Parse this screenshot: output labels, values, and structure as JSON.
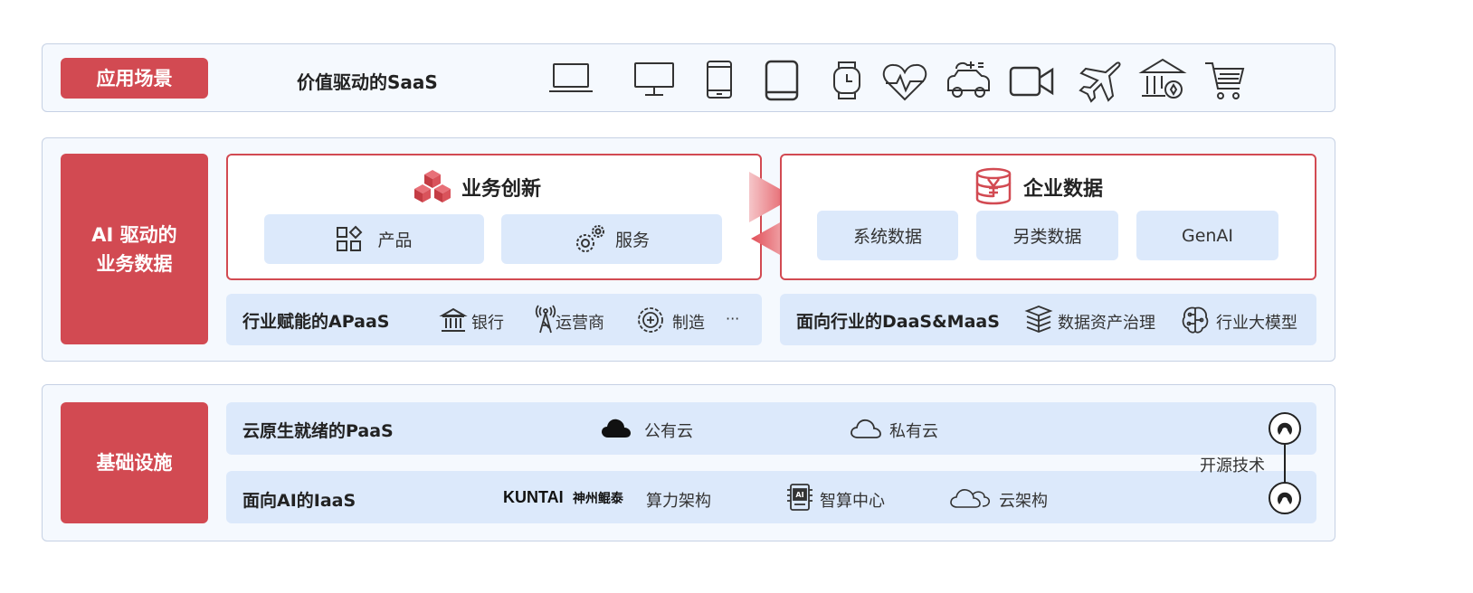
{
  "scenario": {
    "label": "应用场景",
    "title": "价值驱动的SaaS",
    "icons": [
      "laptop-icon",
      "monitor-icon",
      "phone-icon",
      "tablet-icon",
      "watch-icon",
      "health-heart-icon",
      "car-icon",
      "video-camera-icon",
      "airplane-icon",
      "bank-icon",
      "shopping-cart-icon"
    ]
  },
  "ai": {
    "label_line1": "AI 驱动的",
    "label_line2": "业务数据",
    "innovation": {
      "title": "业务创新",
      "items": [
        "产品",
        "服务"
      ]
    },
    "enterprise": {
      "title": "企业数据",
      "items": [
        "系统数据",
        "另类数据",
        "GenAI"
      ]
    },
    "apaas": {
      "title": "行业赋能的APaaS",
      "items": [
        "银行",
        "运营商",
        "制造"
      ],
      "more": "···"
    },
    "daas": {
      "title": "面向行业的DaaS&MaaS",
      "items": [
        "数据资产治理",
        "行业大模型"
      ]
    }
  },
  "infra": {
    "label": "基础设施",
    "paas": {
      "title": "云原生就绪的PaaS",
      "items": [
        "公有云",
        "私有云"
      ]
    },
    "iaas": {
      "title": "面向AI的IaaS",
      "brand": "KUNTAI",
      "brand_cn": "神州鲲泰",
      "items": [
        "算力架构",
        "智算中心",
        "云架构"
      ]
    },
    "open_source": "开源技术"
  },
  "colors": {
    "accent_red": "#d24a52",
    "light_blue": "#dce9fb",
    "panel_bg": "#f5f9fe"
  }
}
